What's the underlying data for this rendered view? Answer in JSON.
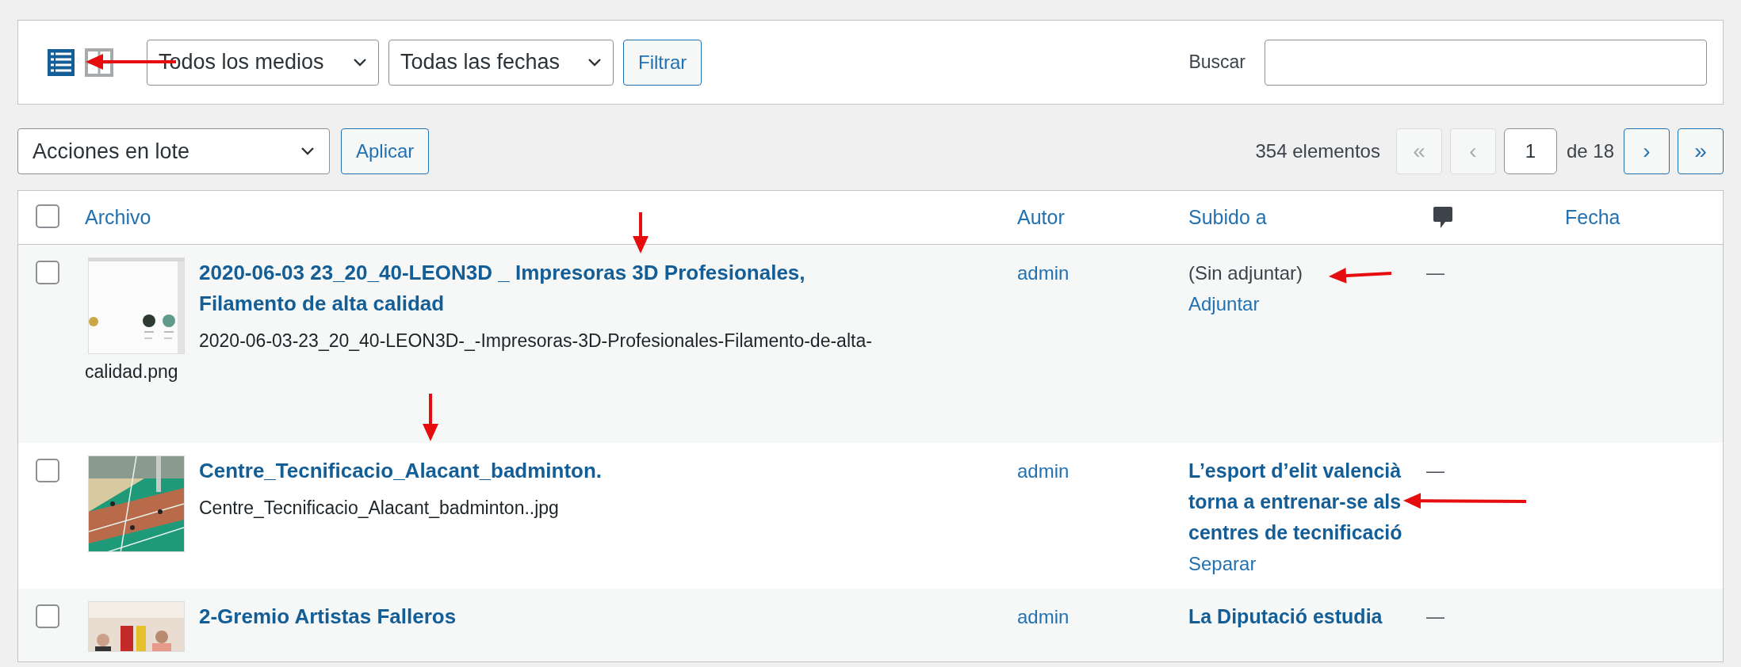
{
  "view_switch": [
    {
      "kind": "list",
      "selected": true
    },
    {
      "kind": "grid",
      "selected": false
    }
  ],
  "filters": {
    "media_select": "Todos los medios",
    "date_select": "Todas las fechas",
    "filter_button": "Filtrar"
  },
  "search": {
    "label": "Buscar"
  },
  "bulk": {
    "select": "Acciones en lote",
    "apply_button": "Aplicar"
  },
  "pagination": {
    "count": "354 elementos",
    "current": "1",
    "total": "de 18",
    "buttons": [
      {
        "label": "«",
        "disabled": true
      },
      {
        "label": "‹",
        "disabled": true
      },
      {
        "label": "›",
        "disabled": false
      },
      {
        "label": "»",
        "disabled": false
      }
    ]
  },
  "table": {
    "select_all": {
      "checked": false
    },
    "columns": [
      {
        "kind": "text",
        "label": "Archivo"
      },
      {
        "kind": "text",
        "label": "Autor"
      },
      {
        "kind": "text",
        "label": "Subido a"
      },
      {
        "kind": "comments"
      },
      {
        "kind": "text",
        "label": "Fecha"
      }
    ],
    "rows": [
      {
        "checked": false,
        "title": "2020-06-03 23_20_40-LEON3D _ Impresoras 3D Profesionales, Filamento de alta calidad",
        "filename": "2020-06-03-23_20_40-LEON3D-_-Impresoras-3D-Profesionales-Filamento-de-alta-calidad.png",
        "author": "admin",
        "uploaded_to": {
          "kind": "unattached",
          "text": "(Sin adjuntar)",
          "action": "Adjuntar"
        },
        "comments": "—"
      },
      {
        "checked": false,
        "title": "Centre_Tecnificacio_Alacant_badminton.",
        "filename": "Centre_Tecnificacio_Alacant_badminton..jpg",
        "author": "admin",
        "uploaded_to": {
          "kind": "post",
          "text": "L’esport d’elit valencià torna a entrenar-se als centres de tecnificació",
          "action": "Separar"
        },
        "comments": "—"
      },
      {
        "checked": false,
        "title": "2-Gremio Artistas Falleros",
        "author": "admin",
        "uploaded_to": {
          "kind": "post",
          "text": "La Diputació estudia"
        },
        "comments": "—"
      }
    ]
  }
}
